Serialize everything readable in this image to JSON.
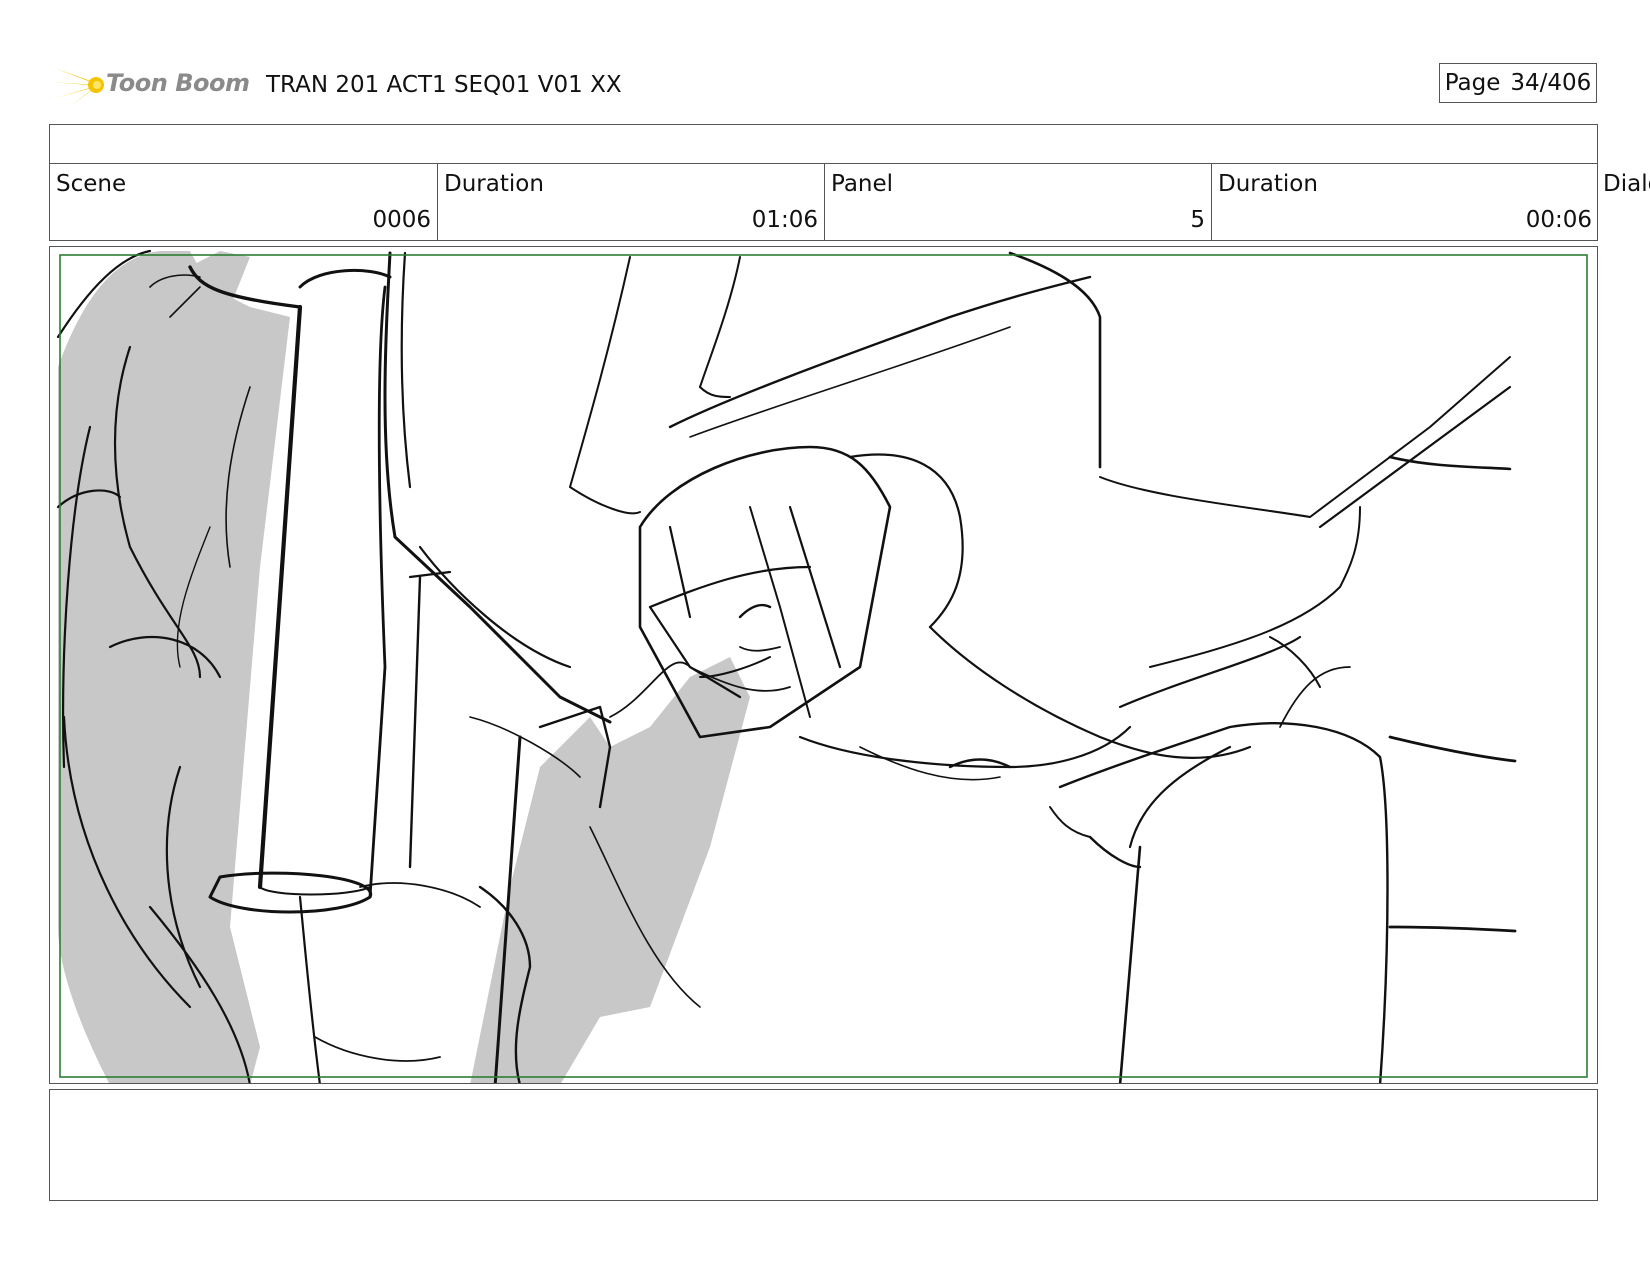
{
  "header": {
    "logo_text": "Toon Boom",
    "title": "TRAN 201 ACT1 SEQ01 V01 XX",
    "page_label": "Page",
    "page_value": "34/406"
  },
  "info": {
    "scene_label": "Scene",
    "scene_value": "0006",
    "scene_duration_label": "Duration",
    "scene_duration_value": "01:06",
    "panel_label": "Panel",
    "panel_value": "5",
    "panel_duration_label": "Duration",
    "panel_duration_value": "00:06",
    "dialog_label": "Dialo"
  },
  "panel": {
    "safe_frame_color": "#2e7d32",
    "shade_color": "#c8c8c8",
    "ink_color": "#111111"
  },
  "notes": {
    "text": ""
  },
  "colors": {
    "logo_accent": "#f5c400",
    "logo_text": "#8a8a8a"
  }
}
